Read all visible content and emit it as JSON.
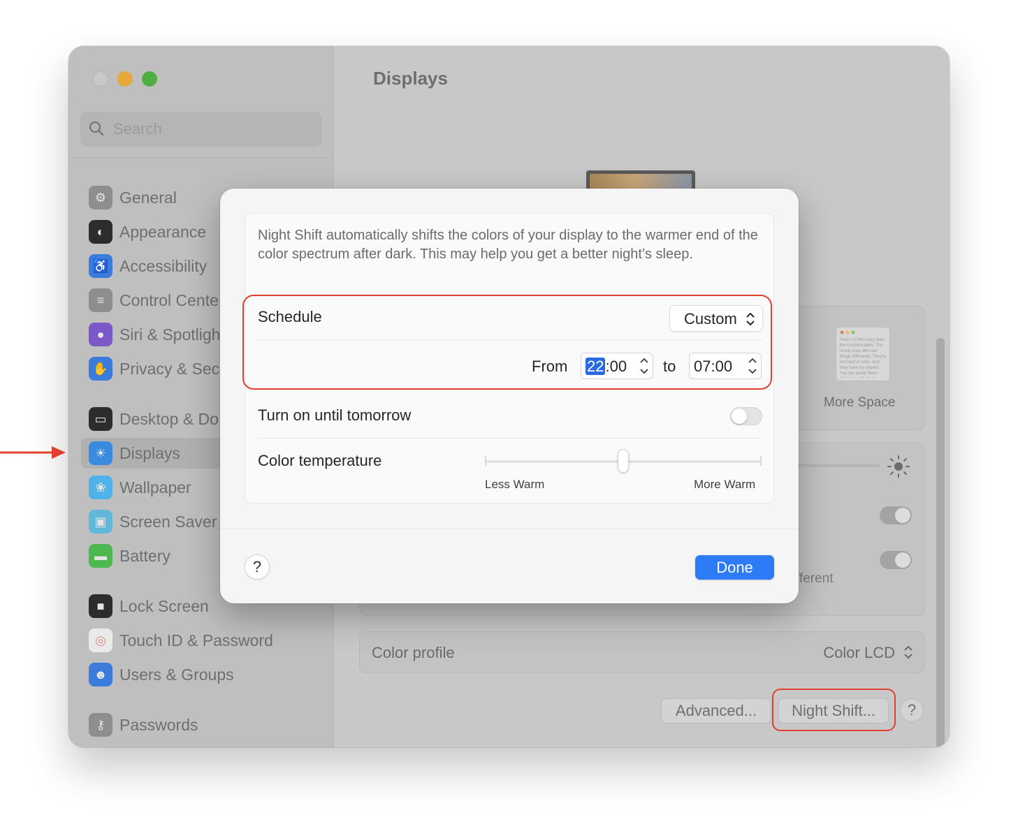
{
  "window": {
    "title": "Displays",
    "traffic_lights": [
      "close",
      "minimize",
      "zoom"
    ]
  },
  "sidebar": {
    "search_placeholder": "Search",
    "items": [
      {
        "label": "General",
        "icon": "gear-icon",
        "color": "#8e8e8e"
      },
      {
        "label": "Appearance",
        "icon": "appearance-icon",
        "color": "#2c2c2c"
      },
      {
        "label": "Accessibility",
        "icon": "accessibility-icon",
        "color": "#3a7bdc"
      },
      {
        "label": "Control Cente",
        "icon": "control-center-icon",
        "color": "#8e8e8e"
      },
      {
        "label": "Siri & Spotligh",
        "icon": "siri-icon",
        "color": "#7b58c7"
      },
      {
        "label": "Privacy & Sec",
        "icon": "hand-icon",
        "color": "#3a7bdc"
      },
      {
        "label": "Desktop & Do",
        "icon": "desktop-icon",
        "color": "#2c2c2c"
      },
      {
        "label": "Displays",
        "icon": "display-icon",
        "color": "#3a8ae0",
        "selected": true
      },
      {
        "label": "Wallpaper",
        "icon": "wallpaper-icon",
        "color": "#4fb2e8"
      },
      {
        "label": "Screen Saver",
        "icon": "screen-saver-icon",
        "color": "#62b8d9"
      },
      {
        "label": "Battery",
        "icon": "battery-icon",
        "color": "#4cb84f"
      },
      {
        "label": "Lock Screen",
        "icon": "lock-icon",
        "color": "#2c2c2c"
      },
      {
        "label": "Touch ID & Password",
        "icon": "fingerprint-icon",
        "color": "#e9e9e9"
      },
      {
        "label": "Users & Groups",
        "icon": "users-icon",
        "color": "#3a7bdc"
      },
      {
        "label": "Passwords",
        "icon": "key-icon",
        "color": "#8e8e8e"
      }
    ]
  },
  "content": {
    "more_space_label": "More Space",
    "mini_window_text": "Here's to the crazy ones the troublemakers. The round ones who see things differently. They're not fond of rules. And they have no respect. You can quote them, disagree with them. About the only thing you can't do. Because they change things.",
    "truncated_text": "fferent",
    "color_profile_label": "Color profile",
    "color_profile_value": "Color LCD",
    "advanced_button": "Advanced...",
    "night_shift_button": "Night Shift...",
    "help_button": "?"
  },
  "night_shift_sheet": {
    "description": "Night Shift automatically shifts the colors of your display to the warmer end of the color spectrum after dark. This may help you get a better night’s sleep.",
    "schedule_label": "Schedule",
    "schedule_value": "Custom",
    "from_label": "From",
    "from_hour": "22",
    "from_rest": ":00",
    "to_label": "to",
    "to_time": "07:00",
    "turn_on_label": "Turn on until tomorrow",
    "turn_on_enabled": false,
    "color_temp_label": "Color temperature",
    "color_temp_value": 0.5,
    "less_warm_label": "Less Warm",
    "more_warm_label": "More Warm",
    "help_button": "?",
    "done_button": "Done"
  },
  "colors": {
    "accent": "#2d7bf6",
    "annotation": "#e0412e"
  }
}
